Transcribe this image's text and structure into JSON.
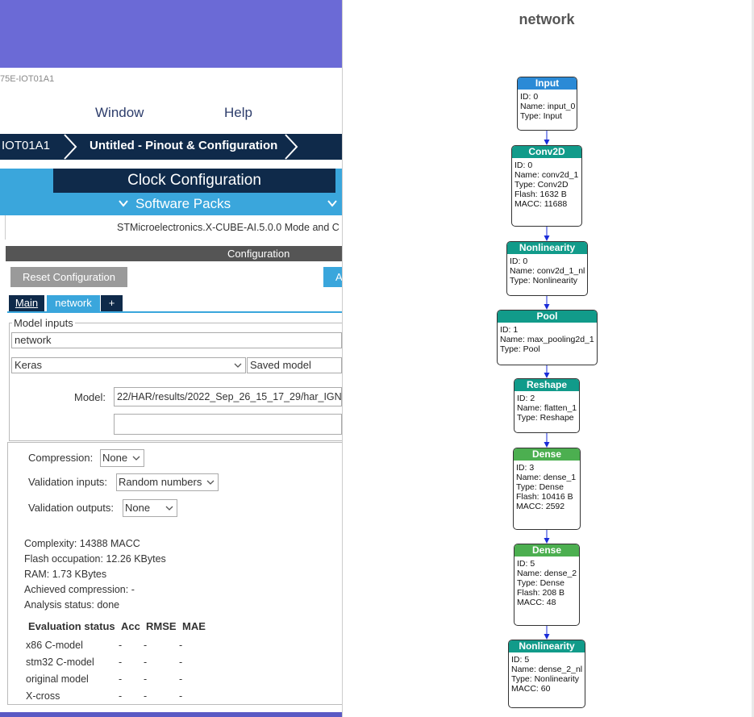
{
  "app": {
    "title_partial": "75E-IOT01A1",
    "menu": [
      "Window",
      "Help"
    ],
    "breadcrumb": [
      "IOT01A1",
      "Untitled - Pinout & Configuration"
    ],
    "clock_tab": "Clock Configuration",
    "software_packs": "Software Packs",
    "mode_text": "STMicroelectronics.X-CUBE-AI.5.0.0 Mode and C",
    "config_title": "Configuration",
    "reset_button": "Reset Configuration",
    "a_button": "A",
    "tabs": [
      "Main",
      "network",
      "+"
    ],
    "model_inputs": {
      "legend": "Model inputs",
      "name": "network",
      "framework": "Keras",
      "model_type": "Saved model",
      "model_label": "Model:",
      "model_path": "22/HAR/results/2022_Sep_26_15_17_29/har_IGN",
      "extra_path": ""
    },
    "settings": {
      "compression_label": "Compression:",
      "compression_value": "None",
      "validation_inputs_label": "Validation inputs:",
      "validation_inputs_value": "Random numbers",
      "validation_outputs_label": "Validation outputs:",
      "validation_outputs_value": "None"
    },
    "stats": [
      "Complexity: 14388 MACC",
      "Flash occupation: 12.26 KBytes",
      "RAM: 1.73 KBytes",
      "Achieved compression: -",
      "Analysis status: done"
    ],
    "evaluation": {
      "headers": [
        "Evaluation status",
        "Acc",
        "RMSE",
        "MAE"
      ],
      "rows": [
        {
          "name": "x86 C-model",
          "acc": "-",
          "rmse": "-",
          "mae": "-"
        },
        {
          "name": "stm32 C-model",
          "acc": "-",
          "rmse": "-",
          "mae": "-"
        },
        {
          "name": "original model",
          "acc": "-",
          "rmse": "-",
          "mae": "-"
        },
        {
          "name": "X-cross",
          "acc": "-",
          "rmse": "-",
          "mae": "-"
        }
      ]
    }
  },
  "graph": {
    "title": "network",
    "colors": {
      "input": "#2b8ad6",
      "teal": "#119b8a",
      "dense": "#4caf50",
      "edge": "#1a2cd8"
    },
    "nodes": [
      {
        "header": "Input",
        "lines": [
          "ID: 0",
          "Name: input_0",
          "Type: Input"
        ]
      },
      {
        "header": "Conv2D",
        "lines": [
          "ID: 0",
          "Name: conv2d_1",
          "Type: Conv2D",
          "Flash: 1632 B",
          "MACC: 11688"
        ]
      },
      {
        "header": "Nonlinearity",
        "lines": [
          "ID: 0",
          "Name: conv2d_1_nl",
          "Type: Nonlinearity"
        ]
      },
      {
        "header": "Pool",
        "lines": [
          "ID: 1",
          "Name: max_pooling2d_1",
          "Type: Pool"
        ]
      },
      {
        "header": "Reshape",
        "lines": [
          "ID: 2",
          "Name: flatten_1",
          "Type: Reshape"
        ]
      },
      {
        "header": "Dense",
        "lines": [
          "ID: 3",
          "Name: dense_1",
          "Type: Dense",
          "Flash: 10416 B",
          "MACC: 2592"
        ]
      },
      {
        "header": "Dense",
        "lines": [
          "ID: 5",
          "Name: dense_2",
          "Type: Dense",
          "Flash: 208 B",
          "MACC: 48"
        ]
      },
      {
        "header": "Nonlinearity",
        "lines": [
          "ID: 5",
          "Name: dense_2_nl",
          "Type: Nonlinearity",
          "MACC: 60"
        ]
      }
    ]
  }
}
